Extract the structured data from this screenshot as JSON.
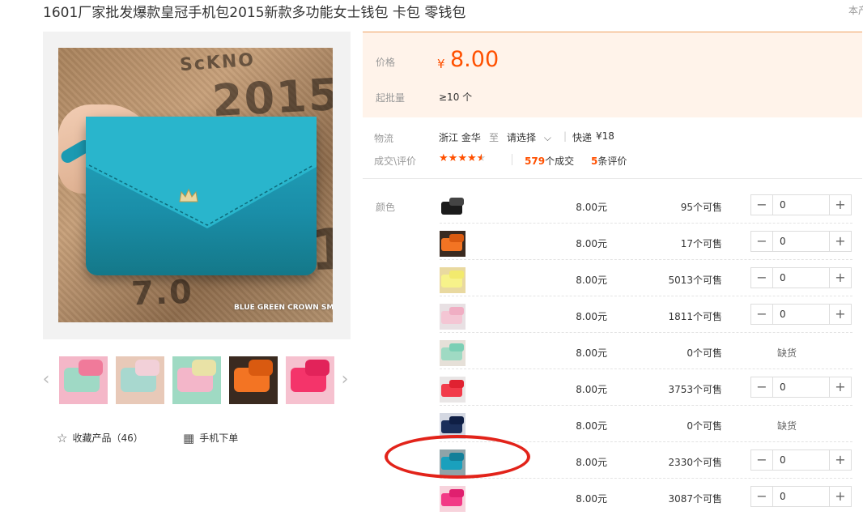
{
  "product": {
    "title": "1601厂家批发爆款皇冠手机包2015新款多功能女士钱包 卡包 零钱包",
    "corner_text": "本产",
    "image_watermark": "BLUE GREEN CROWN SM",
    "thumbnails": [
      {
        "colors": [
          "#f4b7c8",
          "#9fd9c5",
          "#f07a9a"
        ]
      },
      {
        "colors": [
          "#e8c9b8",
          "#a8d8cf",
          "#f2d0d8"
        ]
      },
      {
        "colors": [
          "#9fdac3",
          "#f3b6c9",
          "#e9e2a6"
        ]
      },
      {
        "colors": [
          "#3a2a20",
          "#f37423",
          "#d95a10"
        ]
      },
      {
        "colors": [
          "#f6c1cf",
          "#f4346a",
          "#e2235a"
        ]
      }
    ],
    "favorite_label": "收藏产品（46）",
    "mobile_order_label": "手机下单"
  },
  "price": {
    "label": "价格",
    "currency": "¥",
    "value": "8.00",
    "moq_label": "起批量",
    "moq_value": "≥10 个"
  },
  "logistics": {
    "label": "物流",
    "origin": "浙江 金华",
    "to": "至",
    "select": "请选择",
    "express": "快递",
    "express_price": "¥18"
  },
  "deals": {
    "label": "成交\\评价",
    "rating": 4.5,
    "deals_count": "579",
    "deals_suffix": "个成交",
    "reviews_count": "5",
    "reviews_suffix": "条评价"
  },
  "sku": {
    "color_label": "颜色",
    "rows": [
      {
        "price": "8.00元",
        "stock": "95个可售",
        "qty": "0",
        "oos": "",
        "colors": [
          "#ffffff",
          "#1b1b1b",
          "#444444"
        ]
      },
      {
        "price": "8.00元",
        "stock": "17个可售",
        "qty": "0",
        "oos": "",
        "colors": [
          "#3a2a20",
          "#f37423",
          "#d95a10"
        ]
      },
      {
        "price": "8.00元",
        "stock": "5013个可售",
        "qty": "0",
        "oos": "",
        "colors": [
          "#e9d9a0",
          "#f7f28a",
          "#f2ea6e"
        ]
      },
      {
        "price": "8.00元",
        "stock": "1811个可售",
        "qty": "0",
        "oos": "",
        "colors": [
          "#e8e0e3",
          "#f4c6d4",
          "#f0aec3"
        ]
      },
      {
        "price": "8.00元",
        "stock": "0个可售",
        "qty": "",
        "oos": "缺货",
        "colors": [
          "#e6e0d8",
          "#9fdac3",
          "#7ccfb5"
        ]
      },
      {
        "price": "8.00元",
        "stock": "3753个可售",
        "qty": "0",
        "oos": "",
        "colors": [
          "#e9e6e6",
          "#f23b4a",
          "#e02231"
        ]
      },
      {
        "price": "8.00元",
        "stock": "0个可售",
        "qty": "",
        "oos": "缺货",
        "colors": [
          "#d4d8e2",
          "#1b2f5a",
          "#0f1f45"
        ]
      },
      {
        "price": "8.00元",
        "stock": "2330个可售",
        "qty": "0",
        "oos": "",
        "colors": [
          "#8fa3a8",
          "#1aa0bd",
          "#137f99"
        ]
      },
      {
        "price": "8.00元",
        "stock": "3087个可售",
        "qty": "0",
        "oos": "",
        "colors": [
          "#f7d3dc",
          "#f23a86",
          "#e0206f"
        ]
      }
    ]
  },
  "theme": {
    "accent": "#ff5000",
    "annotation_circle": "#e2231a"
  }
}
